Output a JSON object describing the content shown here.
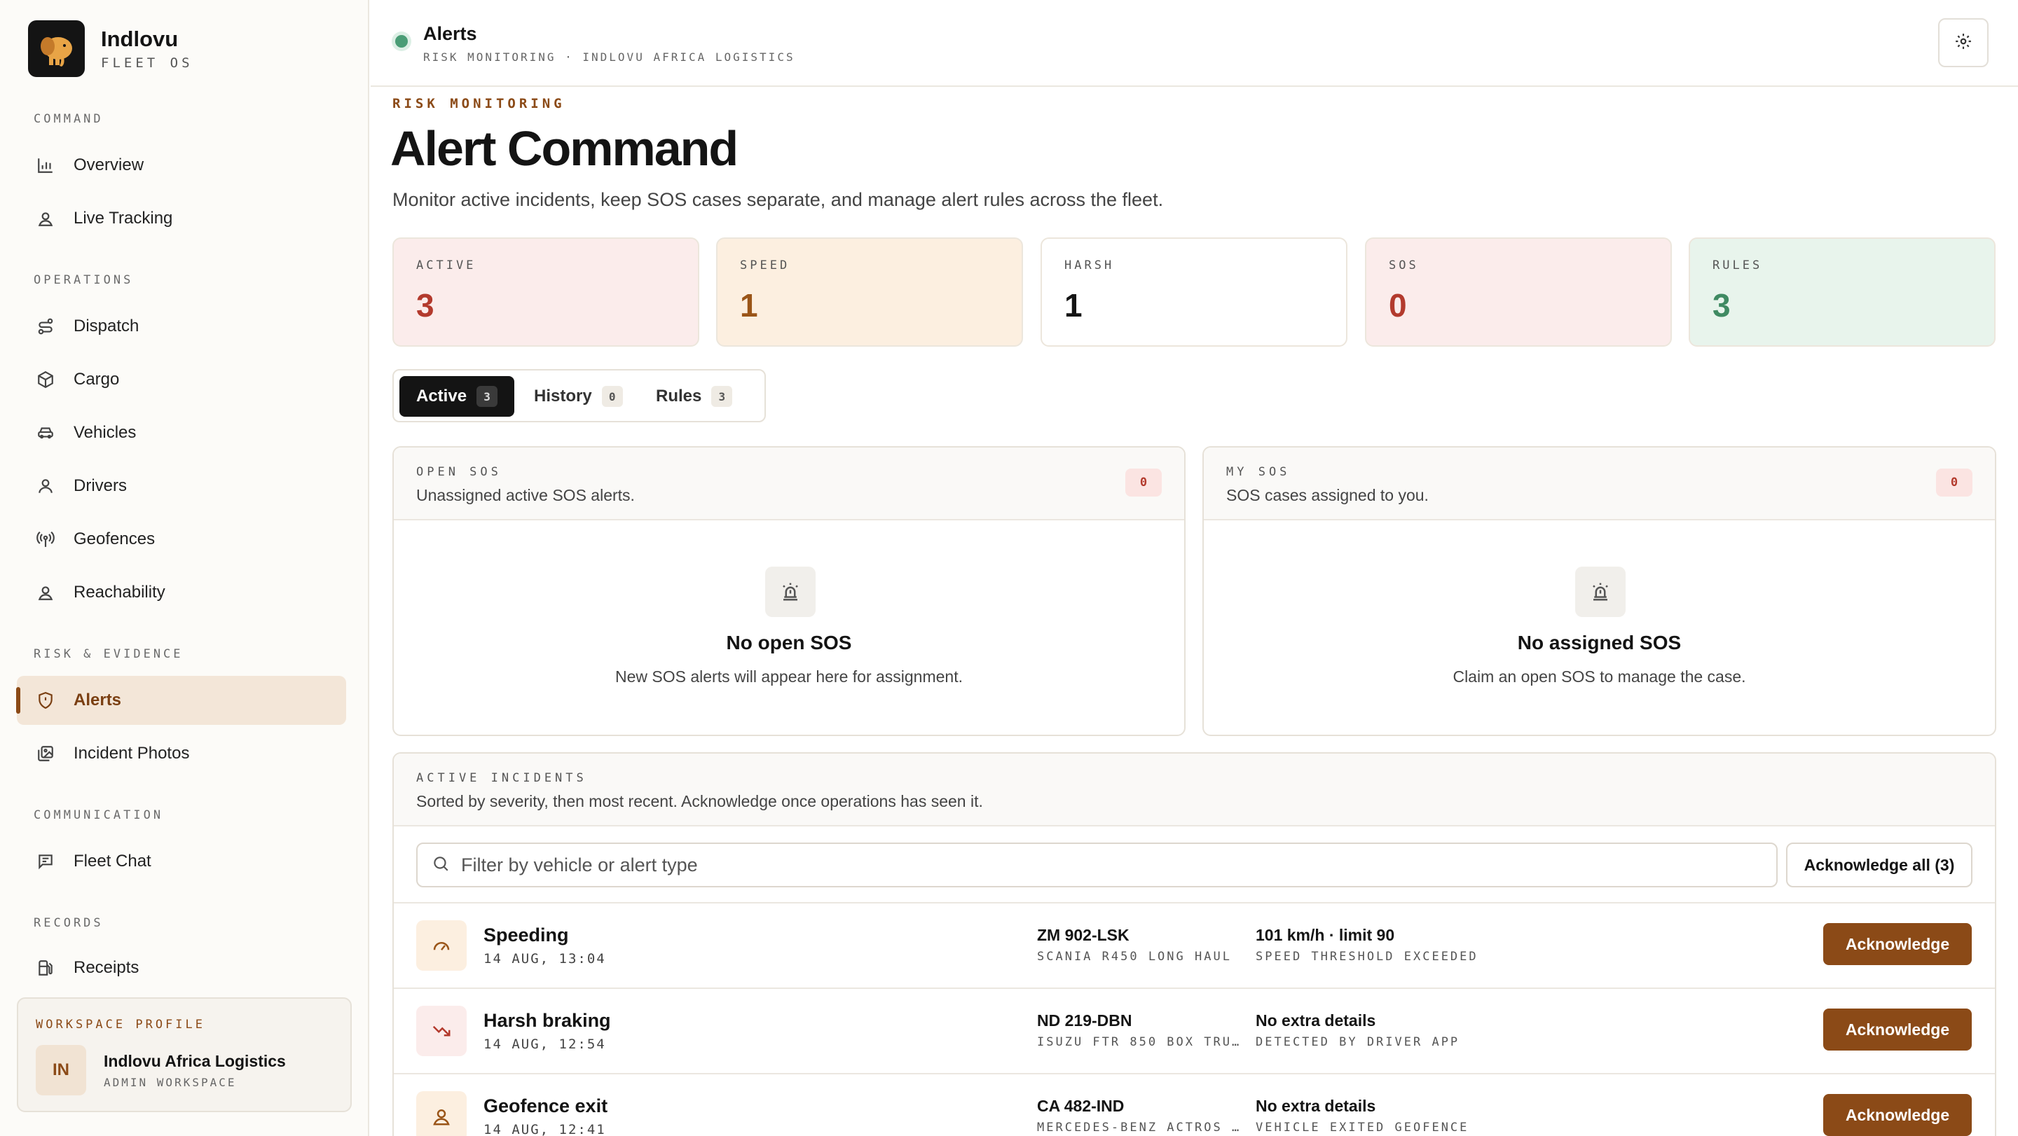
{
  "brand": {
    "name": "Indlovu",
    "subtitle": "FLEET OS"
  },
  "sidebar": {
    "sections": [
      {
        "label": "COMMAND",
        "items": [
          {
            "label": "Overview",
            "icon": "chart-icon"
          },
          {
            "label": "Live Tracking",
            "icon": "person-pin-icon"
          }
        ]
      },
      {
        "label": "OPERATIONS",
        "items": [
          {
            "label": "Dispatch",
            "icon": "route-icon"
          },
          {
            "label": "Cargo",
            "icon": "box-icon"
          },
          {
            "label": "Vehicles",
            "icon": "car-icon"
          },
          {
            "label": "Drivers",
            "icon": "user-icon"
          },
          {
            "label": "Geofences",
            "icon": "radio-icon"
          },
          {
            "label": "Reachability",
            "icon": "person-pin-icon"
          }
        ]
      },
      {
        "label": "RISK & EVIDENCE",
        "items": [
          {
            "label": "Alerts",
            "icon": "shield-icon",
            "active": true
          },
          {
            "label": "Incident Photos",
            "icon": "images-icon"
          }
        ]
      },
      {
        "label": "COMMUNICATION",
        "items": [
          {
            "label": "Fleet Chat",
            "icon": "chat-icon"
          }
        ]
      },
      {
        "label": "RECORDS",
        "items": [
          {
            "label": "Receipts",
            "icon": "fuel-icon"
          }
        ]
      }
    ],
    "workspace": {
      "label": "WORKSPACE PROFILE",
      "initials": "IN",
      "name": "Indlovu Africa Logistics",
      "role": "ADMIN WORKSPACE"
    }
  },
  "header": {
    "title": "Alerts",
    "subtitle": "RISK MONITORING · INDLOVU AFRICA LOGISTICS",
    "status_color": "#4a9d76"
  },
  "page": {
    "eyebrow": "RISK MONITORING",
    "title": "Alert Command",
    "description": "Monitor active incidents, keep SOS cases separate, and manage alert rules across the fleet."
  },
  "stats": [
    {
      "label": "ACTIVE",
      "value": "3",
      "bg": "#fbeceb",
      "color": "#b33a2d"
    },
    {
      "label": "SPEED",
      "value": "1",
      "bg": "#fcefe0",
      "color": "#9a5518"
    },
    {
      "label": "HARSH",
      "value": "1",
      "bg": "#ffffff",
      "color": "#141414"
    },
    {
      "label": "SOS",
      "value": "0",
      "bg": "#fbeceb",
      "color": "#b33a2d"
    },
    {
      "label": "RULES",
      "value": "3",
      "bg": "#e8f4ec",
      "color": "#3f8a62"
    }
  ],
  "tabs": [
    {
      "label": "Active",
      "count": "3",
      "active": true
    },
    {
      "label": "History",
      "count": "0"
    },
    {
      "label": "Rules",
      "count": "3"
    }
  ],
  "open_sos": {
    "label": "OPEN SOS",
    "description": "Unassigned active SOS alerts.",
    "count": "0",
    "empty_title": "No open SOS",
    "empty_desc": "New SOS alerts will appear here for assignment."
  },
  "my_sos": {
    "label": "MY SOS",
    "description": "SOS cases assigned to you.",
    "count": "0",
    "empty_title": "No assigned SOS",
    "empty_desc": "Claim an open SOS to manage the case."
  },
  "incidents": {
    "label": "ACTIVE INCIDENTS",
    "description": "Sorted by severity, then most recent. Acknowledge once operations has seen it.",
    "search_placeholder": "Filter by vehicle or alert type",
    "ack_all_label": "Acknowledge all (3)",
    "rows": [
      {
        "title": "Speeding",
        "time": "14 AUG, 13:04",
        "plate": "ZM 902-LSK",
        "vehicle": "SCANIA R450 LONG HAUL",
        "detail": "101 km/h · limit 90",
        "reason": "SPEED THRESHOLD EXCEEDED",
        "icon": "gauge-icon",
        "action": "Acknowledge"
      },
      {
        "title": "Harsh braking",
        "time": "14 AUG, 12:54",
        "plate": "ND 219-DBN",
        "vehicle": "ISUZU FTR 850 BOX TRU…",
        "detail": "No extra details",
        "reason": "DETECTED BY DRIVER APP",
        "icon": "trend-down-icon",
        "action": "Acknowledge"
      },
      {
        "title": "Geofence exit",
        "time": "14 AUG, 12:41",
        "plate": "CA 482-IND",
        "vehicle": "MERCEDES-BENZ ACTROS …",
        "detail": "No extra details",
        "reason": "VEHICLE EXITED GEOFENCE",
        "icon": "location-person-icon",
        "action": "Acknowledge"
      }
    ]
  }
}
